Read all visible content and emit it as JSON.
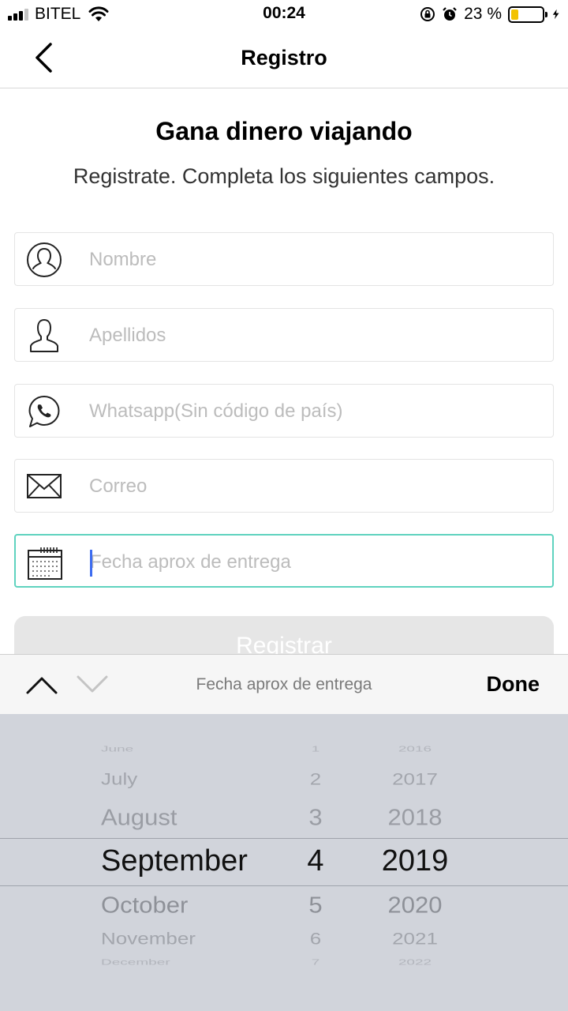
{
  "status_bar": {
    "carrier": "BITEL",
    "time": "00:24",
    "battery_percent": "23 %",
    "battery_level": 0.23,
    "icons": [
      "signal-icon",
      "wifi-icon",
      "orientation-lock-icon",
      "alarm-icon",
      "battery-icon",
      "charging-icon"
    ]
  },
  "nav": {
    "title": "Registro",
    "back_icon": "chevron-left-icon"
  },
  "header": {
    "title": "Gana dinero viajando",
    "subtitle": "Registrate. Completa los siguientes campos."
  },
  "form": {
    "fields": [
      {
        "placeholder": "Nombre",
        "value": "",
        "icon": "user-circle-icon"
      },
      {
        "placeholder": "Apellidos",
        "value": "",
        "icon": "person-icon"
      },
      {
        "placeholder": "Whatsapp(Sin código de país)",
        "value": "",
        "icon": "whatsapp-icon"
      },
      {
        "placeholder": "Correo",
        "value": "",
        "icon": "envelope-icon"
      },
      {
        "placeholder": "Fecha aprox de entrega",
        "value": "",
        "icon": "calendar-icon"
      }
    ],
    "submit_label": "Registrar"
  },
  "toolbar": {
    "label": "Fecha aprox de entrega",
    "done_label": "Done",
    "prev_icon": "chevron-up-icon",
    "next_icon": "chevron-down-icon"
  },
  "picker": {
    "months": [
      "June",
      "July",
      "August",
      "September",
      "October",
      "November",
      "December"
    ],
    "days": [
      "1",
      "2",
      "3",
      "4",
      "5",
      "6",
      "7"
    ],
    "years": [
      "2016",
      "2017",
      "2018",
      "2019",
      "2020",
      "2021",
      "2022"
    ],
    "selected": {
      "month": "September",
      "day": "4",
      "year": "2019"
    }
  }
}
